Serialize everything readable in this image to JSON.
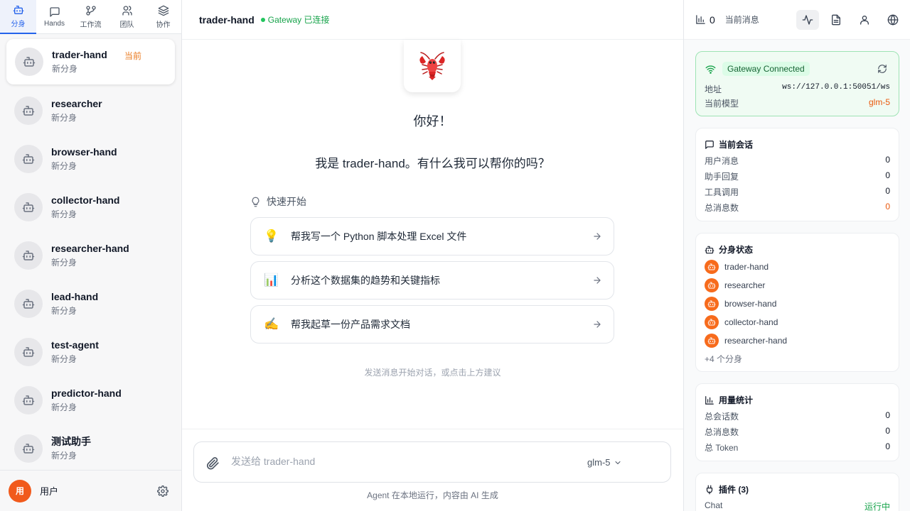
{
  "nav": {
    "tabs": [
      {
        "label": "分身",
        "icon": "bot-icon"
      },
      {
        "label": "Hands",
        "icon": "chat-icon"
      },
      {
        "label": "工作流",
        "icon": "workflow-icon"
      },
      {
        "label": "团队",
        "icon": "team-icon"
      },
      {
        "label": "协作",
        "icon": "layers-icon"
      }
    ]
  },
  "agents": {
    "current_badge": "当前",
    "items": [
      {
        "name": "trader-hand",
        "sub": "新分身"
      },
      {
        "name": "researcher",
        "sub": "新分身"
      },
      {
        "name": "browser-hand",
        "sub": "新分身"
      },
      {
        "name": "collector-hand",
        "sub": "新分身"
      },
      {
        "name": "researcher-hand",
        "sub": "新分身"
      },
      {
        "name": "lead-hand",
        "sub": "新分身"
      },
      {
        "name": "test-agent",
        "sub": "新分身"
      },
      {
        "name": "predictor-hand",
        "sub": "新分身"
      },
      {
        "name": "测试助手",
        "sub": "新分身"
      }
    ]
  },
  "user": {
    "avatar": "用",
    "name": "用户"
  },
  "chat": {
    "title": "trader-hand",
    "status": "Gateway 已连接",
    "greeting": "你好！",
    "intro": "我是 trader-hand。有什么我可以帮你的吗？",
    "quick_title": "快速开始",
    "suggestions": [
      {
        "emoji": "💡",
        "text": "帮我写一个 Python 脚本处理 Excel 文件"
      },
      {
        "emoji": "📊",
        "text": "分析这个数据集的趋势和关键指标"
      },
      {
        "emoji": "✍️",
        "text": "帮我起草一份产品需求文档"
      }
    ],
    "hint": "发送消息开始对话，或点击上方建议",
    "input_placeholder": "发送给 trader-hand",
    "model": "glm-5",
    "footer": "Agent 在本地运行，内容由 AI 生成"
  },
  "right": {
    "count": "0",
    "count_label": "当前消息",
    "gateway": {
      "status": "Gateway Connected",
      "addr_label": "地址",
      "addr": "ws://127.0.0.1:50051/ws",
      "model_label": "当前模型",
      "model": "glm-5"
    },
    "session": {
      "title": "当前会话",
      "rows": [
        {
          "k": "用户消息",
          "v": "0"
        },
        {
          "k": "助手回复",
          "v": "0"
        },
        {
          "k": "工具调用",
          "v": "0"
        },
        {
          "k": "总消息数",
          "v": "0"
        }
      ]
    },
    "agent_status": {
      "title": "分身状态",
      "items": [
        "trader-hand",
        "researcher",
        "browser-hand",
        "collector-hand",
        "researcher-hand"
      ],
      "more": "+4 个分身"
    },
    "usage": {
      "title": "用量统计",
      "rows": [
        {
          "k": "总会话数",
          "v": "0"
        },
        {
          "k": "总消息数",
          "v": "0"
        },
        {
          "k": "总 Token",
          "v": "0"
        }
      ]
    },
    "plugins": {
      "title": "插件 (3)",
      "rows": [
        {
          "k": "Chat",
          "v": "运行中"
        }
      ]
    }
  },
  "colors": {
    "accent": "#2563eb",
    "brand_orange": "#f76b1c",
    "success": "#16a34a"
  }
}
